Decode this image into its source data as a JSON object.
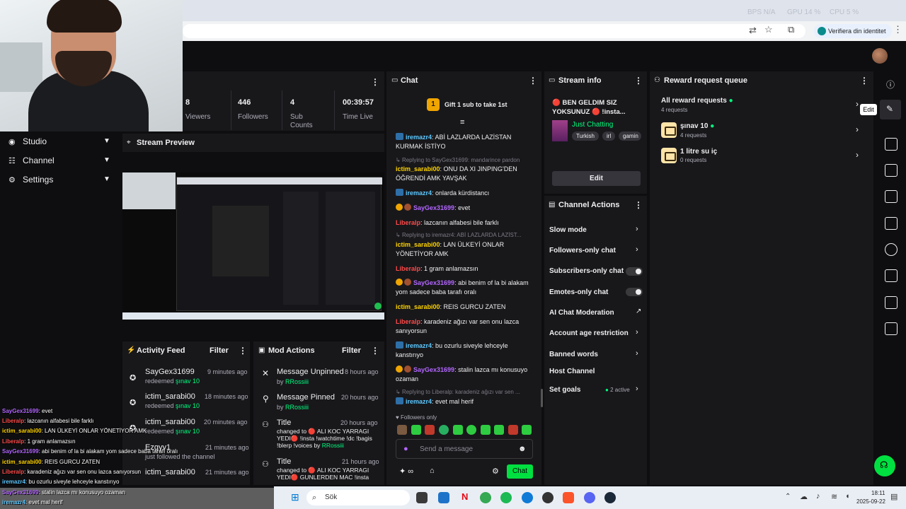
{
  "browser": {
    "stats": [
      "BPS N/A",
      "GPU 14 %",
      "CPU 5 %"
    ],
    "verify_label": "Verifiera din identitet"
  },
  "sidebar": {
    "items": [
      {
        "label": "Studio"
      },
      {
        "label": "Channel"
      },
      {
        "label": "Settings"
      }
    ]
  },
  "stats": {
    "viewers": {
      "value": "8",
      "label": "Viewers"
    },
    "followers": {
      "value": "446",
      "label": "Followers"
    },
    "subs": {
      "value": "4",
      "label": "Sub Counts"
    },
    "time": {
      "value": "00:39:57",
      "label": "Time Live"
    }
  },
  "preview": {
    "title": "Stream Preview"
  },
  "activity": {
    "title": "Activity Feed",
    "filter": "Filter",
    "rows": [
      {
        "name": "SayGex31699",
        "sub_pre": "redeemed ",
        "sub_hl": "şınav 10",
        "time": "9 minutes ago"
      },
      {
        "name": "ictim_sarabi00",
        "sub_pre": "redeemed ",
        "sub_hl": "şınav 10",
        "time": "18 minutes ago"
      },
      {
        "name": "ictim_sarabi00",
        "sub_pre": "redeemed ",
        "sub_hl": "şınav 10",
        "time": "20 minutes ago"
      },
      {
        "name": "Ezgyy1",
        "sub_pre": "just followed the channel",
        "sub_hl": "",
        "time": "21 minutes ago"
      },
      {
        "name": "ictim_sarabi00",
        "sub_pre": "",
        "sub_hl": "",
        "time": "21 minutes ago"
      }
    ]
  },
  "mod": {
    "title": "Mod Actions",
    "filter": "Filter",
    "rows": [
      {
        "title": "Message Unpinned",
        "by": "by ",
        "user": "RRossiii",
        "time": "8 hours ago"
      },
      {
        "title": "Message Pinned",
        "by": "by ",
        "user": "RRossiii",
        "time": "20 hours ago"
      },
      {
        "title": "Title",
        "detail": "changed to 🔴 ALI KOC YARRAGI YEDI🔴 !insta !watchtime !dc !bagis !blerp !voices by ",
        "user": "RRossiii",
        "time": "20 hours ago"
      },
      {
        "title": "Title",
        "detail": "changed to 🔴 ALI KOC YARRAGI YEDI🔴 GUNLERDEN MAC !insta",
        "user": "",
        "time": "21 hours ago"
      }
    ]
  },
  "chat": {
    "title": "Chat",
    "gift": "Gift 1 sub to take 1st",
    "gift_count": "1",
    "followers_only": "Followers only",
    "placeholder": "Send a message",
    "send": "Chat",
    "messages": [
      {
        "type": "msg",
        "user": "iremazr4",
        "cls": "ire",
        "text": ": ABİ LAZLARDA LAZİSTAN KURMAK İSTİYO"
      },
      {
        "type": "reply",
        "text": "Replying to SayGex31699: mandarince pardon"
      },
      {
        "type": "msg",
        "user": "ictim_sarabi00",
        "cls": "ict",
        "text": ": ONU DA XI JINPING'DEN ÖĞRENDİ AMK YAVŞAK"
      },
      {
        "type": "msg",
        "user": "iremazr4",
        "cls": "ire",
        "text": ": onlarda kürdistancı"
      },
      {
        "type": "msg",
        "user": "SayGex31699",
        "cls": "say",
        "text": ": evet"
      },
      {
        "type": "msg",
        "user": "Liberalp",
        "cls": "lib",
        "text": ": lazcanın alfabesi bile farklı"
      },
      {
        "type": "reply",
        "text": "Replying to iremazr4: ABİ LAZLARDA LAZİST..."
      },
      {
        "type": "msg",
        "user": "ictim_sarabi00",
        "cls": "ict",
        "text": ": LAN ÜLKEYİ ONLAR YÖNETİYOR AMK"
      },
      {
        "type": "msg",
        "user": "Liberalp",
        "cls": "lib",
        "text": ": 1 gram anlamazsın"
      },
      {
        "type": "msg",
        "user": "SayGex31699",
        "cls": "say",
        "text": ": abi benim of la bi alakam yom sadece baba tarafı oralı"
      },
      {
        "type": "msg",
        "user": "ictim_sarabi00",
        "cls": "ict",
        "text": ": REIS GURCU ZATEN"
      },
      {
        "type": "msg",
        "user": "Liberalp",
        "cls": "lib",
        "text": ": karadeniz ağızı var sen onu lazca sanıyorsun"
      },
      {
        "type": "msg",
        "user": "iremazr4",
        "cls": "ire",
        "text": ": bu ozurlu siveyle lehceyle kanstırıyo"
      },
      {
        "type": "msg",
        "user": "SayGex31699",
        "cls": "say",
        "text": ": stalin lazca mı konusuyo ozaman"
      },
      {
        "type": "reply",
        "text": "Replying to Liberalp: karadeniz ağızı var sen ..."
      },
      {
        "type": "msg",
        "user": "iremazr4",
        "cls": "ire",
        "text": ": evet mal herif"
      }
    ]
  },
  "stream_info": {
    "title": "Stream info",
    "stream_title": "🔴 BEN GELDIM SIZ YOKSUNUZ 🔴 !insta...",
    "category": "Just Chatting",
    "tags": [
      "Turkish",
      "irl",
      "gamin"
    ],
    "edit": "Edit"
  },
  "channel_actions": {
    "title": "Channel Actions",
    "items": [
      {
        "label": "Slow mode"
      },
      {
        "label": "Followers-only chat"
      },
      {
        "label": "Subscribers-only chat"
      },
      {
        "label": "Emotes-only chat"
      },
      {
        "label": "AI Chat Moderation"
      },
      {
        "label": "Account age restriction"
      },
      {
        "label": "Banned words"
      },
      {
        "label": "Host Channel"
      },
      {
        "label": "Set goals"
      }
    ],
    "goals_badge": "2 active"
  },
  "rewards": {
    "title": "Reward request queue",
    "all": "All reward requests",
    "all_count": "4 requests",
    "items": [
      {
        "name": "şınav 10",
        "count": "4 requests"
      },
      {
        "name": "1 litre su iç",
        "count": "0 requests"
      }
    ],
    "tooltip": "Edit"
  },
  "overlay": [
    {
      "user": "SayGex31699",
      "text": ": evet"
    },
    {
      "user": "Liberalp",
      "text": ": lazcanın alfabesi bile farklı"
    },
    {
      "user": "ictim_sarabi00",
      "text": ": LAN ÜLKEYİ ONLAR YÖNETİYOR AMK"
    },
    {
      "user": "Liberalp",
      "text": ": 1 gram anlamazsın"
    },
    {
      "user": "SayGex31699",
      "text": ": abi benim of la bi alakam yom sadece baba tarafı oralı"
    },
    {
      "user": "ictim_sarabi00",
      "text": ": REIS GURCU ZATEN"
    },
    {
      "user": "Liberalp",
      "text": ": karadeniz ağızı var sen onu lazca sanıyorsun"
    },
    {
      "user": "iremazr4",
      "text": ": bu ozurlu siveyle lehceyle kanstırıyo"
    },
    {
      "user": "SayGex31699",
      "text": ": stalin lazca mı konusuyo ozaman"
    },
    {
      "user": "iremazr4",
      "text": ": evet mal herif"
    }
  ],
  "taskbar": {
    "search": "Sök",
    "time": "18:11",
    "date": "2025-09-22"
  }
}
